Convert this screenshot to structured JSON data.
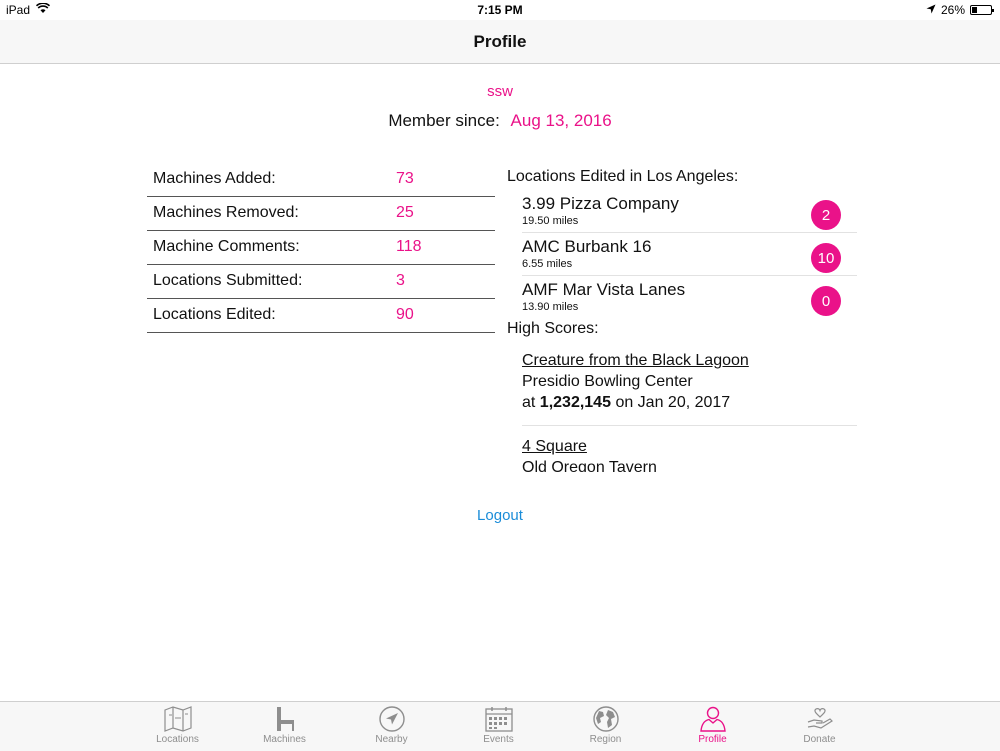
{
  "status": {
    "device": "iPad",
    "time": "7:15 PM",
    "battery": "26%"
  },
  "nav": {
    "title": "Profile"
  },
  "profile": {
    "username": "ssw",
    "member_label": "Member since:",
    "member_date": "Aug 13, 2016"
  },
  "stats": [
    {
      "label": "Machines Added:",
      "value": "73"
    },
    {
      "label": "Machines Removed:",
      "value": "25"
    },
    {
      "label": "Machine Comments:",
      "value": "118"
    },
    {
      "label": "Locations Submitted:",
      "value": "3"
    },
    {
      "label": "Locations Edited:",
      "value": "90"
    }
  ],
  "locations": {
    "title": "Locations Edited in Los Angeles:",
    "items": [
      {
        "name": "3.99 Pizza Company",
        "distance": "19.50 miles",
        "count": "2"
      },
      {
        "name": "AMC Burbank 16",
        "distance": "6.55 miles",
        "count": "10"
      },
      {
        "name": "AMF Mar Vista Lanes",
        "distance": "13.90 miles",
        "count": "0"
      }
    ]
  },
  "high_scores": {
    "title": "High Scores:",
    "items": [
      {
        "machine": "Creature from the Black Lagoon",
        "location": "Presidio Bowling Center",
        "prefix": "at",
        "score": "1,232,145",
        "date": "on Jan 20, 2017"
      },
      {
        "machine": "4 Square",
        "location": "Old Oregon Tavern"
      }
    ]
  },
  "logout": "Logout",
  "tabs": [
    {
      "label": "Locations",
      "icon": "map-icon"
    },
    {
      "label": "Machines",
      "icon": "pinball-machine-icon"
    },
    {
      "label": "Nearby",
      "icon": "location-arrow-icon"
    },
    {
      "label": "Events",
      "icon": "calendar-icon"
    },
    {
      "label": "Region",
      "icon": "globe-icon"
    },
    {
      "label": "Profile",
      "icon": "person-icon",
      "active": true
    },
    {
      "label": "Donate",
      "icon": "heart-hand-icon"
    }
  ],
  "colors": {
    "accent": "#ea1289",
    "link": "#1a8cd8"
  }
}
